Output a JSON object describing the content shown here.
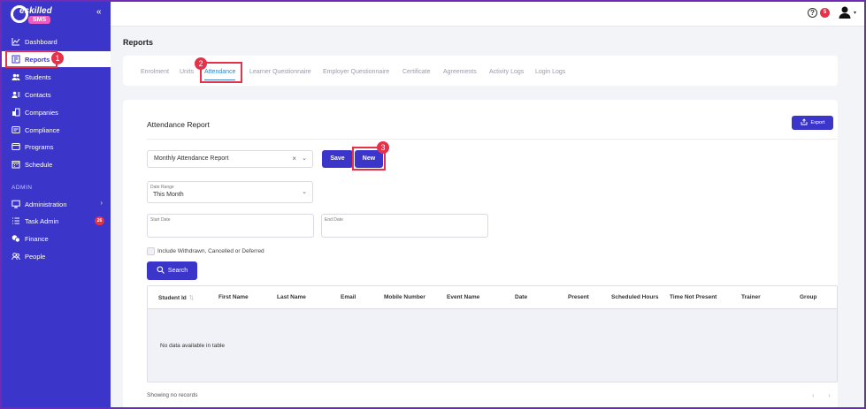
{
  "sidebar": {
    "logo_word": "eskilled",
    "logo_badge": "SMS",
    "collapse_icon": "«",
    "items": [
      {
        "label": "Dashboard",
        "icon": "chart-line-icon"
      },
      {
        "label": "Reports",
        "icon": "report-icon"
      },
      {
        "label": "Students",
        "icon": "students-icon"
      },
      {
        "label": "Contacts",
        "icon": "contacts-icon"
      },
      {
        "label": "Companies",
        "icon": "companies-icon"
      },
      {
        "label": "Compliance",
        "icon": "compliance-icon"
      },
      {
        "label": "Programs",
        "icon": "programs-icon"
      },
      {
        "label": "Schedule",
        "icon": "schedule-icon"
      }
    ],
    "admin_heading": "ADMIN",
    "admin_items": [
      {
        "label": "Administration",
        "icon": "monitor-icon",
        "chevron": "›"
      },
      {
        "label": "Task Admin",
        "icon": "tasks-icon",
        "badge": "26"
      },
      {
        "label": "Finance",
        "icon": "finance-icon"
      },
      {
        "label": "People",
        "icon": "people-icon"
      }
    ]
  },
  "topbar": {
    "help": "?",
    "notification_count": "5"
  },
  "callouts": [
    "1",
    "2",
    "3"
  ],
  "page": {
    "title": "Reports"
  },
  "tabs": [
    "Enrolment",
    "Units",
    "Attendance",
    "Learner Questionnaire",
    "Employer Questionnaire",
    "Certificate",
    "Agreements",
    "Activity Logs",
    "Login Logs"
  ],
  "report": {
    "title": "Attendance Report",
    "export_label": "Export",
    "selected_report": "Monthly Attendance Report",
    "clear_icon": "×",
    "save_label": "Save",
    "new_label": "New",
    "date_range_label": "Date Range",
    "date_range_value": "This Month",
    "start_date_label": "Start Date",
    "end_date_label": "End Date",
    "include_label": "Include Withdrawn, Cancelled or Deferred",
    "search_label": "Search"
  },
  "table": {
    "columns": [
      "Student Id",
      "First Name",
      "Last Name",
      "Email",
      "Mobile Number",
      "Event Name",
      "Date",
      "Present",
      "Scheduled Hours",
      "Time Not Present",
      "Trainer",
      "Group"
    ],
    "empty_message": "No data available in table",
    "records_text": "Showing no records",
    "prev": "‹",
    "next": "›"
  },
  "colors": {
    "accent": "#3b35c9",
    "highlight": "#e5314a",
    "active_tab": "#2f86c8"
  }
}
